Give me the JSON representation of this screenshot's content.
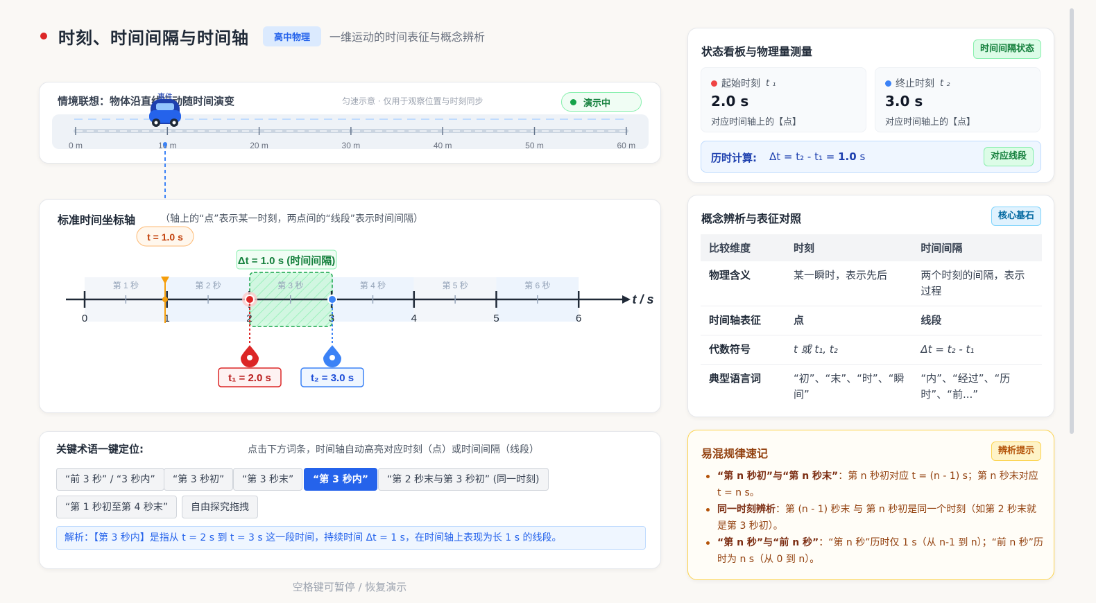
{
  "header": {
    "title": "时刻、时间间隔与时间轴",
    "tag": "高中物理",
    "subtitle": "一维运动的时间表征与概念辨析"
  },
  "scene": {
    "label": "情境联想：物体沿直线运动随时间演变",
    "hint": "匀速示意 · 仅用于观察位置与时刻同步",
    "demo_badge": "演示中",
    "vehicle_tag": "事件",
    "ruler_labels": [
      "0 m",
      "10 m",
      "20 m",
      "30 m",
      "40 m",
      "50 m",
      "60 m"
    ]
  },
  "timeline": {
    "title": "标准时间坐标轴",
    "desc": "（轴上的“点”表示某一时刻，两点间的“线段”表示时间间隔）",
    "cursor_label": "t = 1.0 s",
    "interval_label": "Δt = 1.0 s (时间间隔)",
    "axis_label": "t / s",
    "second_labels": [
      "第 1 秒",
      "第 2 秒",
      "第 3 秒",
      "第 4 秒",
      "第 5 秒",
      "第 6 秒"
    ],
    "tick_labels": [
      "0",
      "1",
      "2",
      "3",
      "4",
      "5",
      "6"
    ],
    "t1_label": "t₁ = 2.0 s",
    "t2_label": "t₂ = 3.0 s"
  },
  "terms": {
    "title": "关键术语一键定位:",
    "hint": "点击下方词条，时间轴自动高亮对应时刻（点）或时间间隔（线段）",
    "chips": [
      "“前 3 秒” / “3 秒内”",
      "“第 3 秒初”",
      "“第 3 秒末”",
      "“第 3 秒内”",
      "“第 2 秒末与第 3 秒初” (同一时刻)",
      "“第 1 秒初至第 4 秒末”",
      "自由探究拖拽"
    ],
    "analysis": "解析：【第 3 秒内】是指从 t = 2 s 到 t = 3 s 这一段时间，持续时间 Δt = 1 s，在时间轴上表现为长 1 s 的线段。"
  },
  "footer_hint": "空格键可暂停 / 恢复演示",
  "status": {
    "title": "状态看板与物理量测量",
    "badge": "时间间隔状态",
    "start": {
      "label": "起始时刻",
      "symbol": "t ₁",
      "value": "2.0 s",
      "note": "对应时间轴上的【点】"
    },
    "end": {
      "label": "终止时刻",
      "symbol": "t ₂",
      "value": "3.0 s",
      "note": "对应时间轴上的【点】"
    },
    "calc_label": "历时计算:",
    "calc_formula": "Δt = t₂ - t₁ = ",
    "calc_result": "1.0",
    "calc_unit": " s",
    "calc_badge": "对应线段"
  },
  "concept": {
    "title": "概念辨析与表征对照",
    "badge": "核心基石",
    "headers": [
      "比较维度",
      "时刻",
      "时间间隔"
    ],
    "rows": [
      {
        "dim": "物理含义",
        "moment": "某一瞬时，表示先后",
        "interval": "两个时刻的间隔，表示过程"
      },
      {
        "dim": "时间轴表征",
        "moment": "点",
        "interval": "线段"
      },
      {
        "dim": "代数符号",
        "moment": "t 或 t₁, t₂",
        "interval": "Δt = t₂ - t₁"
      },
      {
        "dim": "典型语言词",
        "moment": "“初”、“末”、“时”、“瞬间”",
        "interval": "“内”、“经过”、“历时”、“前...”"
      }
    ]
  },
  "tips": {
    "title": "易混规律速记",
    "badge": "辨析提示",
    "items": [
      {
        "strong": "“第 n 秒初”与“第 n 秒末”",
        "text": "：第 n 秒初对应 t = (n - 1) s；第 n 秒末对应 t = n s。"
      },
      {
        "strong": "同一时刻辨析",
        "text": "：第 (n - 1) 秒末 与 第 n 秒初是同一个时刻（如第 2 秒末就是第 3 秒初）。"
      },
      {
        "strong": "“第 n 秒”与“前 n 秒”",
        "text": "：“第 n 秒”历时仅 1 s（从 n-1 到 n）；“前 n 秒”历时为 n s（从 0 到 n）。"
      }
    ]
  },
  "colors": {
    "accent": "#2563eb",
    "moment_red": "#dc2626",
    "interval_green": "#16a34a",
    "cursor_orange": "#f59e0b"
  }
}
